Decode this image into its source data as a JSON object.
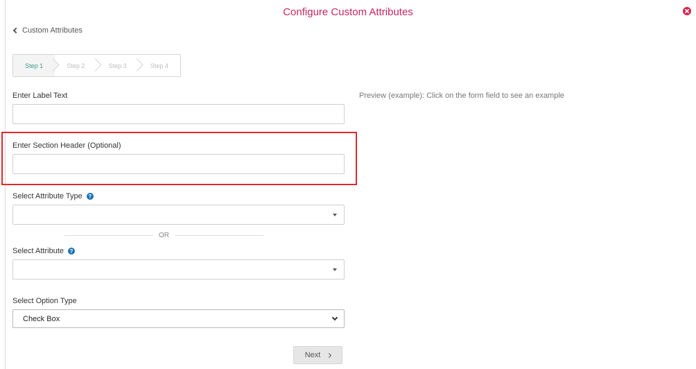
{
  "header": {
    "title": "Configure Custom Attributes",
    "close_icon": "close-circle-icon",
    "close_color": "#d6264f"
  },
  "breadcrumb": {
    "back_label": "Custom Attributes"
  },
  "steps": [
    {
      "label": "Step 1",
      "active": true
    },
    {
      "label": "Step 2",
      "active": false
    },
    {
      "label": "Step 3",
      "active": false
    },
    {
      "label": "Step 4",
      "active": false
    }
  ],
  "form": {
    "label_text": {
      "label": "Enter Label Text",
      "value": ""
    },
    "section_header": {
      "label": "Enter Section Header (Optional)",
      "value": ""
    },
    "attribute_type": {
      "label": "Select Attribute Type",
      "value": "",
      "help_icon": "question-circle-icon"
    },
    "or_text": "OR",
    "attribute": {
      "label": "Select Attribute",
      "value": "",
      "help_icon": "question-circle-icon"
    },
    "option_type": {
      "label": "Select Option Type",
      "value": "Check Box"
    },
    "next_label": "Next"
  },
  "preview": {
    "text": "Preview (example): Click on the form field to see an example"
  },
  "colors": {
    "title": "#c8255e",
    "active_step": "#3a9e8a",
    "highlight": "#e0282c",
    "help_icon": "#1c6fb5"
  }
}
